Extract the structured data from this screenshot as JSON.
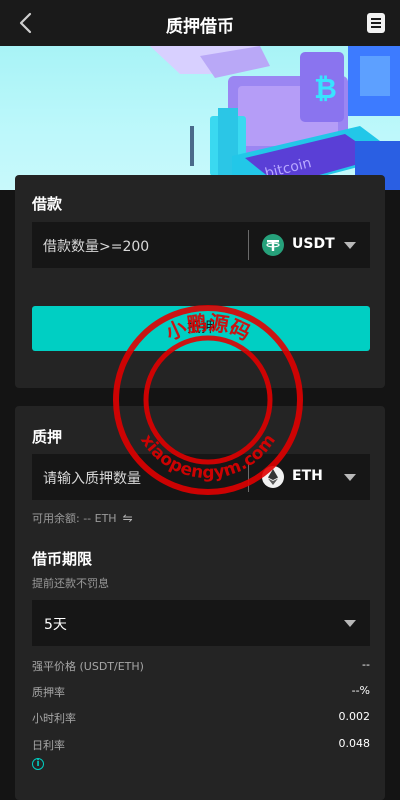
{
  "header": {
    "title": "质押借币"
  },
  "borrow": {
    "title": "借款",
    "amount_placeholder": "借款数量>=200",
    "coin": "USDT",
    "submit_label": "抵押"
  },
  "pledge": {
    "title": "质押",
    "amount_placeholder": "请输入质押数量",
    "coin": "ETH",
    "balance_text": "可用余额: -- ETH"
  },
  "term": {
    "title": "借币期限",
    "note": "提前还款不罚息",
    "selected": "5天"
  },
  "stats": [
    {
      "label": "强平价格 (USDT/ETH)",
      "value": "--"
    },
    {
      "label": "质押率",
      "value": "--%"
    },
    {
      "label": "小时利率",
      "value": "0.002"
    },
    {
      "label": "日利率",
      "value": "0.048"
    }
  ],
  "banner": {
    "label": "bitcoin",
    "symbol": "₿"
  },
  "watermark": {
    "top_text": "小鹏源码",
    "bottom_text": "xiaopengym.com"
  },
  "colors": {
    "accent": "#00cfc3",
    "usdt": "#26a17b",
    "stamp": "#e00000"
  }
}
